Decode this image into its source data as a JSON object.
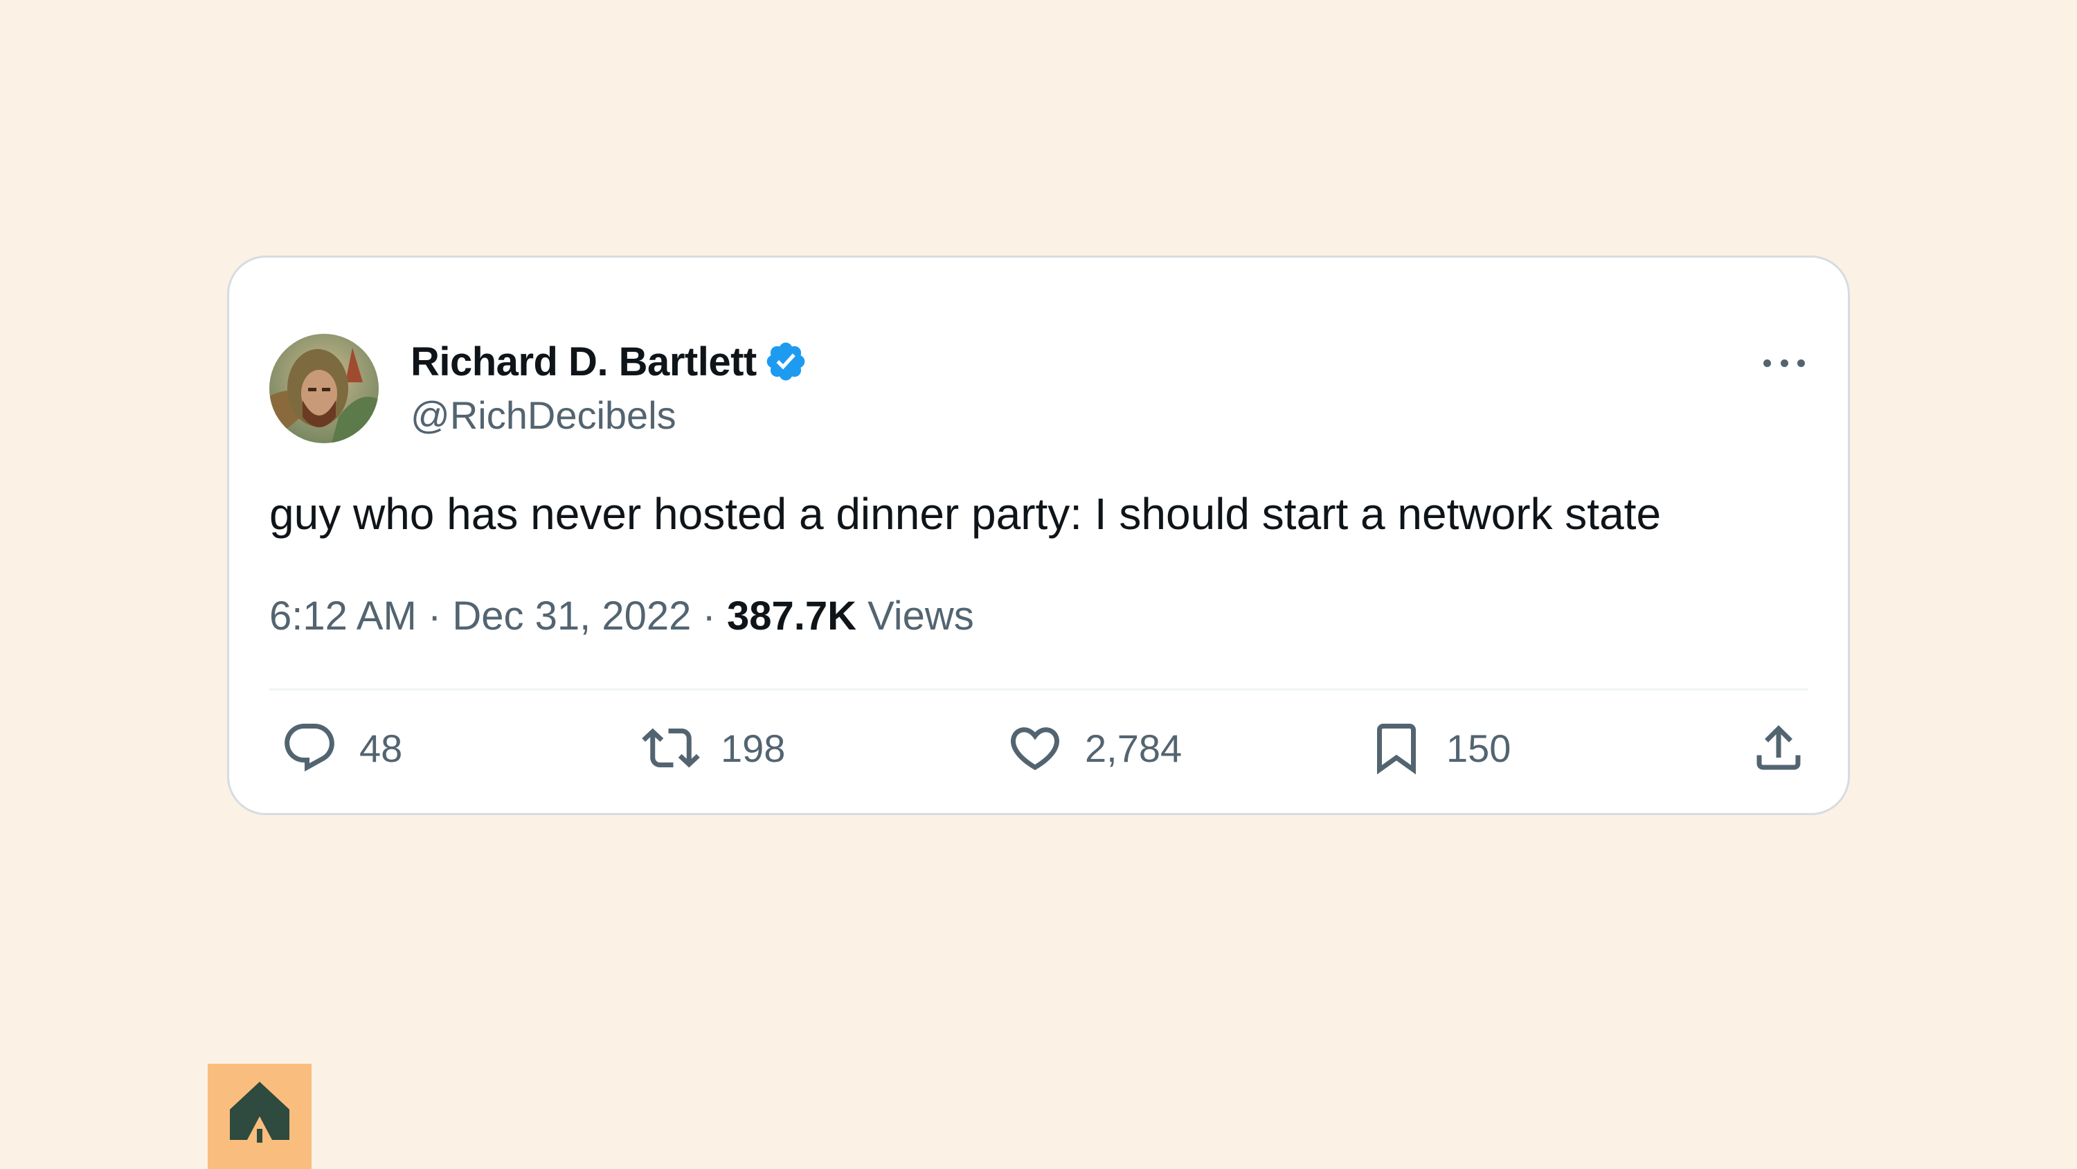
{
  "tweet": {
    "author": {
      "display_name": "Richard D. Bartlett",
      "handle": "@RichDecibels",
      "verified": true
    },
    "text": "guy who has never hosted a dinner party: I should start a network state",
    "time": "6:12 AM",
    "separator": "·",
    "date": "Dec 31, 2022",
    "views_count": "387.7K",
    "views_label": "Views",
    "actions": {
      "replies": "48",
      "retweets": "198",
      "likes": "2,784",
      "bookmarks": "150"
    }
  },
  "icons": {
    "verified": "verified-badge-icon",
    "more": "more-horizontal-icon",
    "reply": "reply-icon",
    "retweet": "retweet-icon",
    "like": "heart-icon",
    "bookmark": "bookmark-icon",
    "share": "share-icon",
    "brand": "house-tree-logo"
  },
  "colors": {
    "background": "#fcf1e5",
    "card": "#ffffff",
    "text_primary": "#0f1419",
    "text_secondary": "#536471",
    "verified_blue": "#1d9bf0",
    "logo_bg": "#f9be7d",
    "logo_fg": "#2f4a3e"
  }
}
